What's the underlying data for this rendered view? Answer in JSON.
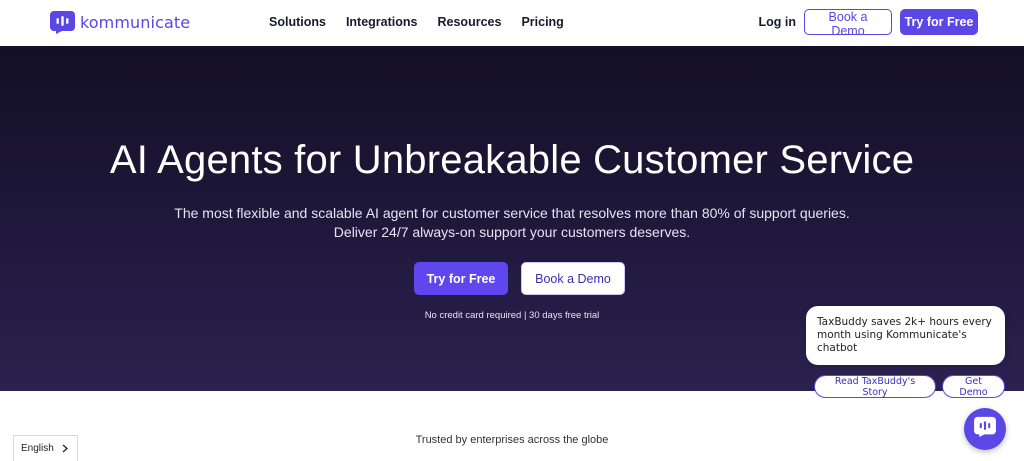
{
  "brand": {
    "name": "kommunicate",
    "color": "#5b46e6"
  },
  "nav": {
    "links": [
      "Solutions",
      "Integrations",
      "Resources",
      "Pricing"
    ],
    "login": "Log in",
    "book_demo": "Book a Demo",
    "try_free": "Try for Free"
  },
  "hero": {
    "title": "AI Agents for Unbreakable Customer Service",
    "subtitle_line1": "The most flexible and scalable AI agent for customer service that resolves more than 80% of support queries.",
    "subtitle_line2": "Deliver 24/7 always-on support your customers deserves.",
    "try_free": "Try for Free",
    "book_demo": "Book a Demo",
    "note": "No credit card required | 30 days free trial"
  },
  "trusted": "Trusted by enterprises across the globe",
  "language": {
    "selected": "English",
    "icon": "chevron-right-icon"
  },
  "chat": {
    "message": "TaxBuddy saves 2k+ hours every month using Kommunicate's chatbot",
    "chip_story": "Read TaxBuddy's Story",
    "chip_demo": "Get Demo",
    "launcher_icon": "chat-icon"
  }
}
